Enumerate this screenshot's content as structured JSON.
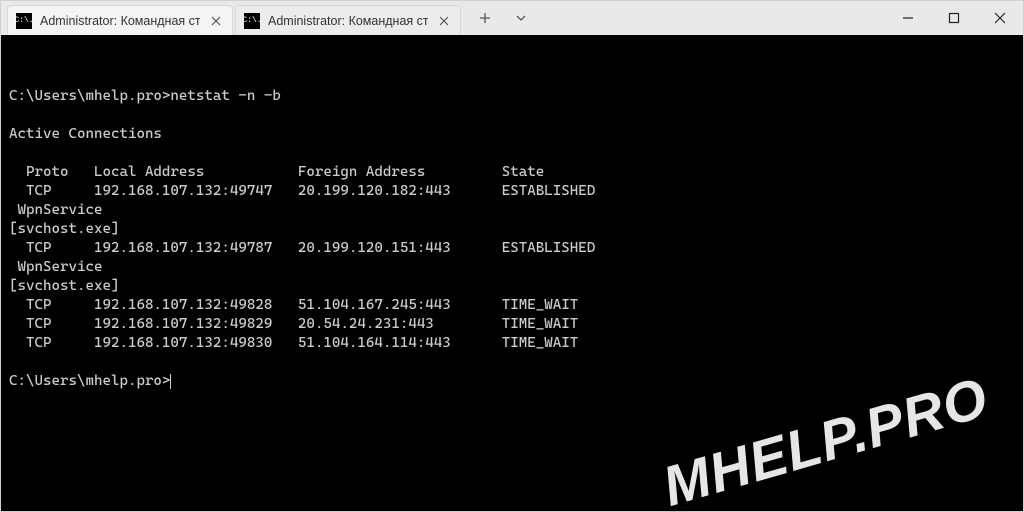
{
  "tabs": [
    {
      "title": "Administrator: Командная стро",
      "icon_text": "C:\\."
    },
    {
      "title": "Administrator: Командная стро",
      "icon_text": "C:\\."
    }
  ],
  "terminal": {
    "prompt1_prefix": "C:\\Users\\mhelp.pro>",
    "command": "netstat -n -b",
    "header_blank": "",
    "section_title": "Active Connections",
    "cols": {
      "proto": "Proto",
      "local": "Local Address",
      "foreign": "Foreign Address",
      "state": "State"
    },
    "rows": [
      {
        "proto": "TCP",
        "local": "192.168.107.132:49747",
        "foreign": "20.199.120.182:443",
        "state": "ESTABLISHED",
        "service": "WpnService",
        "exec": "[svchost.exe]"
      },
      {
        "proto": "TCP",
        "local": "192.168.107.132:49787",
        "foreign": "20.199.120.151:443",
        "state": "ESTABLISHED",
        "service": "WpnService",
        "exec": "[svchost.exe]"
      },
      {
        "proto": "TCP",
        "local": "192.168.107.132:49828",
        "foreign": "51.104.167.245:443",
        "state": "TIME_WAIT"
      },
      {
        "proto": "TCP",
        "local": "192.168.107.132:49829",
        "foreign": "20.54.24.231:443",
        "state": "TIME_WAIT"
      },
      {
        "proto": "TCP",
        "local": "192.168.107.132:49830",
        "foreign": "51.104.164.114:443",
        "state": "TIME_WAIT"
      }
    ],
    "prompt2_prefix": "C:\\Users\\mhelp.pro>"
  },
  "watermark": "MHELP.PRO"
}
